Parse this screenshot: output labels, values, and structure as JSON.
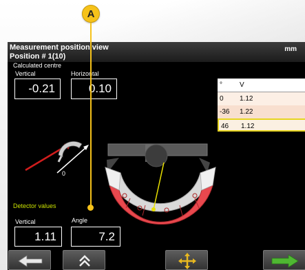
{
  "callout": {
    "letter": "A",
    "color": "#f6c21a"
  },
  "header": {
    "title": "Measurement position view",
    "subtitle": "Position # 1(10)",
    "unit": "mm"
  },
  "calculated_centre": {
    "heading": "Calculated centre",
    "vertical_label": "Vertical",
    "vertical_value": "-0.21",
    "horizontal_label": "Horizontal",
    "horizontal_value": "0.10"
  },
  "angle_table": {
    "columns": [
      "°",
      "V"
    ],
    "rows": [
      {
        "angle": "0",
        "v": "1.12"
      },
      {
        "angle": "-36",
        "v": "1.22"
      },
      {
        "angle": "46",
        "v": "1.12"
      }
    ],
    "highlight_color": "#e6d41e"
  },
  "rotation_indicator": {
    "label": "0"
  },
  "detector_values": {
    "heading": "Detector values",
    "vertical_label": "Vertical",
    "vertical_value": "1.11",
    "angle_label": "Angle",
    "angle_value": "7.2"
  },
  "toolbar": {
    "buttons": [
      {
        "icon": "arrow-left-icon"
      },
      {
        "icon": "chevron-double-up-icon"
      },
      {
        "icon": "move-arrows-icon"
      },
      {
        "icon": "arrow-right-icon"
      }
    ]
  },
  "colors": {
    "accent_green": "#c9e000",
    "gauge_red": "#e8484e",
    "arrow_green": "#4fb832"
  }
}
